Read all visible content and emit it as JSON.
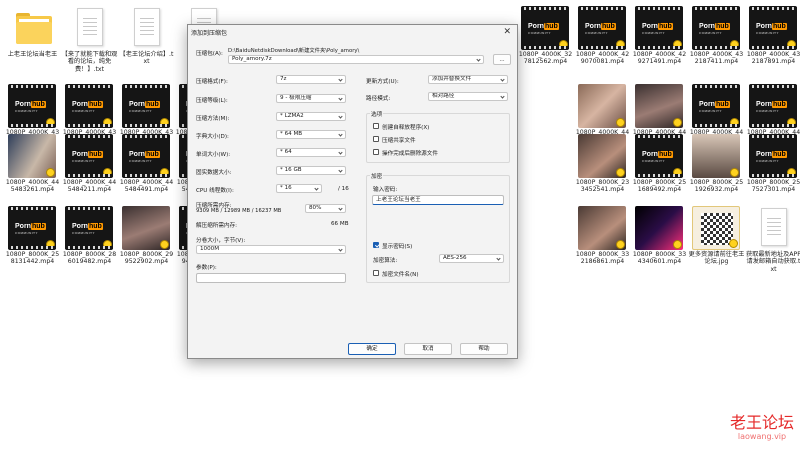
{
  "files": [
    {
      "kind": "folder",
      "label": "上老王论坛当老王"
    },
    {
      "kind": "txt",
      "label": "【来了就能下载和观看的论坛，纯免费！】.txt"
    },
    {
      "kind": "txt",
      "label": "【老王论坛介绍】.txt"
    },
    {
      "kind": "txt",
      "label": "【老王论坛…"
    },
    {
      "kind": "hidden",
      "label": ""
    },
    {
      "kind": "hidden",
      "label": ""
    },
    {
      "kind": "hidden",
      "label": ""
    },
    {
      "kind": "hidden",
      "label": ""
    },
    {
      "kind": "hidden",
      "label": ""
    },
    {
      "kind": "video",
      "label": "1080P_4000K_327812562.mp4"
    },
    {
      "kind": "video",
      "label": "1080P_4000K_429070081.mp4"
    },
    {
      "kind": "video",
      "label": "1080P_4000K_429271491.mp4"
    },
    {
      "kind": "video",
      "label": "1080P_4000K_432187411.mp4"
    },
    {
      "kind": "video",
      "label": "1080P_4000K_432187891.mp4"
    },
    {
      "kind": "video",
      "label": "1080P_4000K_432191901.mp4"
    },
    {
      "kind": "video",
      "label": "1080P_4000K_437697781.mp4"
    },
    {
      "kind": "video",
      "label": "1080P_4000K_438283781.mp4"
    },
    {
      "kind": "video",
      "label": "1080P_4000K_4…"
    },
    {
      "kind": "hidden",
      "label": ""
    },
    {
      "kind": "hidden",
      "label": ""
    },
    {
      "kind": "hidden",
      "label": ""
    },
    {
      "kind": "hidden",
      "label": ""
    },
    {
      "kind": "hidden",
      "label": ""
    },
    {
      "kind": "hidden",
      "label": ""
    },
    {
      "kind": "photo1",
      "label": "1080P_4000K_445476521.mp4"
    },
    {
      "kind": "photo2",
      "label": "1080P_4000K_445482411.mp4"
    },
    {
      "kind": "video",
      "label": "1080P_4000K_445482821.mp4"
    },
    {
      "kind": "video",
      "label": "1080P_4000K_445483061.mp4"
    },
    {
      "kind": "photo3",
      "label": "1080P_4000K_445483261.mp4"
    },
    {
      "kind": "video",
      "label": "1080P_4000K_445484211.mp4"
    },
    {
      "kind": "video",
      "label": "1080P_4000K_445484491.mp4"
    },
    {
      "kind": "video",
      "label": "1080P_4000K_445484611.mp4"
    },
    {
      "kind": "video",
      "label": "1080P_4000K_4…"
    },
    {
      "kind": "hidden",
      "label": ""
    },
    {
      "kind": "hidden",
      "label": ""
    },
    {
      "kind": "hidden",
      "label": ""
    },
    {
      "kind": "hidden",
      "label": ""
    },
    {
      "kind": "hidden",
      "label": ""
    },
    {
      "kind": "photo4",
      "label": "1080P_8000K_233452541.mp4"
    },
    {
      "kind": "video",
      "label": "1080P_8000K_251689492.mp4"
    },
    {
      "kind": "photo6",
      "label": "1080P_8000K_251926932.mp4"
    },
    {
      "kind": "video",
      "label": "1080P_8000K_257527301.mp4"
    },
    {
      "kind": "video",
      "label": "1080P_8000K_258131442.mp4"
    },
    {
      "kind": "video",
      "label": "1080P_8000K_286019482.mp4"
    },
    {
      "kind": "photo2",
      "label": "1080P_8000K_299522902.mp4"
    },
    {
      "kind": "video",
      "label": "1080P_8000K_319401811.mp4"
    },
    {
      "kind": "video",
      "label": "1080P_8000K_3…"
    },
    {
      "kind": "hidden",
      "label": ""
    },
    {
      "kind": "hidden",
      "label": ""
    },
    {
      "kind": "hidden",
      "label": ""
    },
    {
      "kind": "hidden",
      "label": ""
    },
    {
      "kind": "hidden",
      "label": ""
    },
    {
      "kind": "photo4",
      "label": "1080P_8000K_332186861.mp4"
    },
    {
      "kind": "photo5",
      "label": "1080P_8000K_334340601.mp4"
    },
    {
      "kind": "qr",
      "label": "更多资源请前往老王论坛.jpg"
    },
    {
      "kind": "txt",
      "label": "获取最新地址及APP请发邮箱自动获取.txt"
    }
  ],
  "dialog": {
    "title": "添加到压缩包",
    "close_glyph": "✕",
    "archive_label": "压缩包(A):",
    "archive_path": "D:\\BaiduNetdiskDownload\\新建文件夹\\Poly_amory\\",
    "archive_name": "Poly_amory.7z",
    "browse_label": "...",
    "format_label": "压缩格式(F):",
    "format_value": "7z",
    "level_label": "压缩等级(L):",
    "level_value": "9 - 极限压缩",
    "method_label": "压缩方法(M):",
    "method_value": "* LZMA2",
    "dict_label": "字典大小(D):",
    "dict_value": "* 64 MB",
    "word_label": "单词大小(W):",
    "word_value": "* 64",
    "solid_label": "固实数据大小:",
    "solid_value": "* 16 GB",
    "threads_label": "CPU 线程数(I):",
    "threads_value": "* 16",
    "threads_max": "/ 16",
    "mem_label": "压缩所需内存:",
    "mem_value": "9309 MB / 12989 MB / 16237 MB",
    "mem_percent": "80%",
    "decomp_label": "解压缩所需内存:",
    "decomp_value": "66 MB",
    "split_label": "分卷大小，字节(V):",
    "split_value": "1000M",
    "params_label": "参数(P):",
    "update_label": "更新方式(U):",
    "update_value": "添加并替换文件",
    "path_label": "路径模式:",
    "path_value": "相对路径",
    "options_title": "选项",
    "opt_sfx": "创建自释放程序(X)",
    "opt_shared": "压缩共享文件",
    "opt_delete": "操作完成后删除源文件",
    "encrypt_title": "加密",
    "pwd_label": "输入密码:",
    "pwd_value": "上老王论坛当老王",
    "show_pwd": "显示密码(S)",
    "enc_method_label": "加密算法:",
    "enc_method_value": "AES-256",
    "enc_names": "加密文件名(N)",
    "ok": "确定",
    "cancel": "取消",
    "help": "帮助"
  },
  "watermark": {
    "text": "老王论坛",
    "url": "laowang.vip"
  }
}
